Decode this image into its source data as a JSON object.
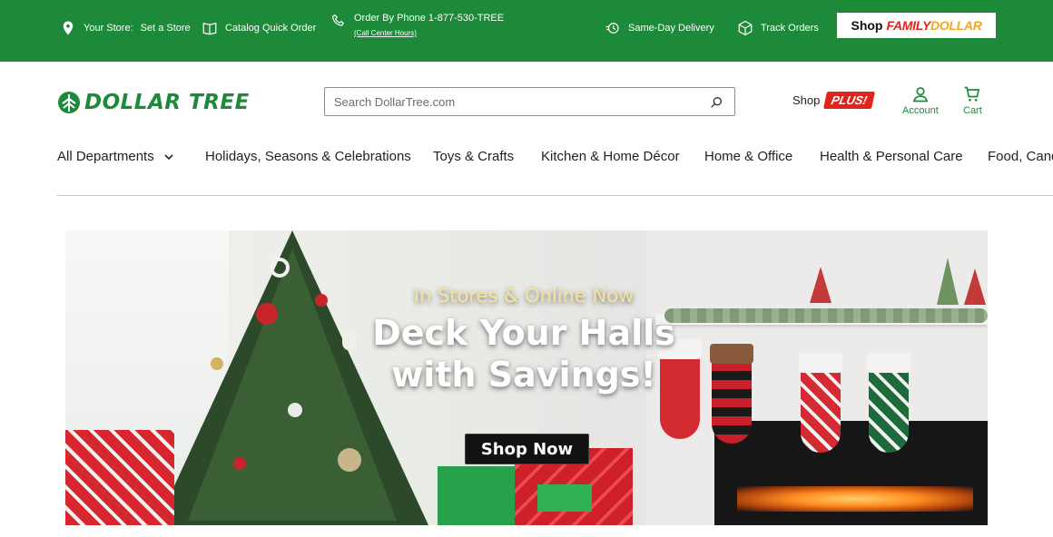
{
  "topbar": {
    "store_label": "Your Store:",
    "store_action": "Set a Store",
    "catalog": "Catalog Quick Order",
    "phone": "Order By Phone 1-877-530-TREE",
    "phone_sub": "(Call Center Hours)",
    "delivery": "Same-Day Delivery",
    "track": "Track Orders",
    "fd_shop": "Shop",
    "fd_brand_a": "FAMILY",
    "fd_brand_b": "DOLLAR",
    "colors": {
      "bar": "#1d8a3a",
      "brand_red": "#e2231a",
      "brand_orange": "#f5a623"
    }
  },
  "header": {
    "logo_text": "DOLLAR TREE",
    "search_placeholder": "Search DollarTree.com",
    "shop_label": "Shop",
    "plus_label": "PLUS!",
    "account_label": "Account",
    "cart_label": "Cart"
  },
  "nav": {
    "items": [
      "All Departments",
      "Holidays, Seasons & Celebrations",
      "Toys & Crafts",
      "Kitchen & Home Décor",
      "Home & Office",
      "Health & Personal Care",
      "Food, Cand"
    ]
  },
  "hero": {
    "subtitle": "In Stores & Online Now",
    "title_line1": "Deck Your Halls",
    "title_line2": "with Savings!",
    "cta": "Shop Now"
  }
}
